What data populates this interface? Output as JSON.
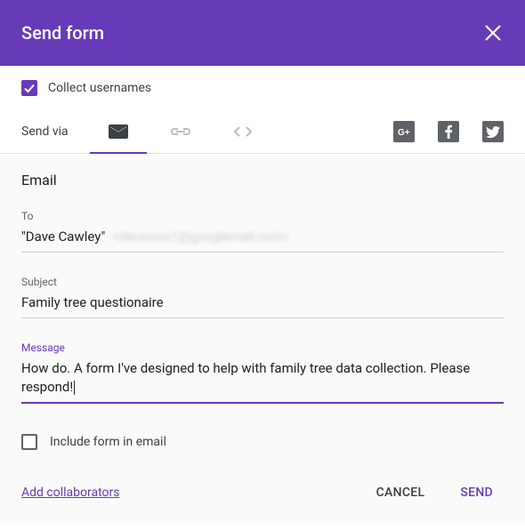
{
  "header": {
    "title": "Send form"
  },
  "collect": {
    "label": "Collect usernames",
    "checked": true
  },
  "sendvia": {
    "label": "Send via"
  },
  "email": {
    "section_title": "Email",
    "to_label": "To",
    "to_name": "\"Dave Cawley\"",
    "to_email": "<davexxxx1@googlemail.com>",
    "subject_label": "Subject",
    "subject_value": "Family tree questionaire",
    "message_label": "Message",
    "message_value": "How do. A form I've designed to help with family tree data collection. Please respond!"
  },
  "include": {
    "label": "Include form in email",
    "checked": false
  },
  "footer": {
    "add_collaborators": "Add collaborators",
    "cancel": "Cancel",
    "send": "Send"
  }
}
